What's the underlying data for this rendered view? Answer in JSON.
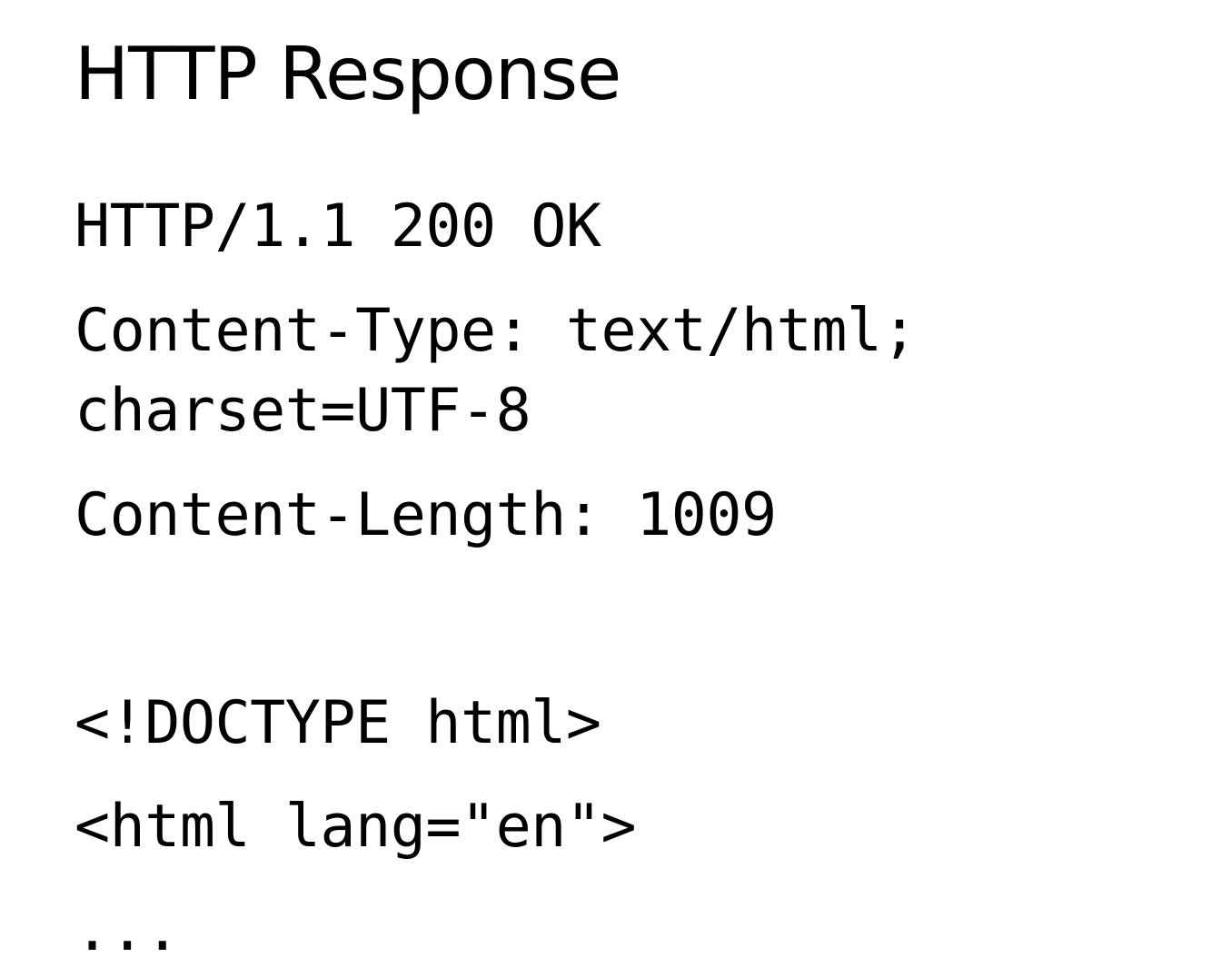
{
  "title": "HTTP Response",
  "response": {
    "status_line": "HTTP/1.1 200 OK",
    "content_type_line_1": "Content-Type: text/html;",
    "content_type_line_2": "charset=UTF-8",
    "content_length": "Content-Length: 1009",
    "body_line_1": "<!DOCTYPE html>",
    "body_line_2": "<html lang=\"en\">",
    "body_line_3": "..."
  }
}
